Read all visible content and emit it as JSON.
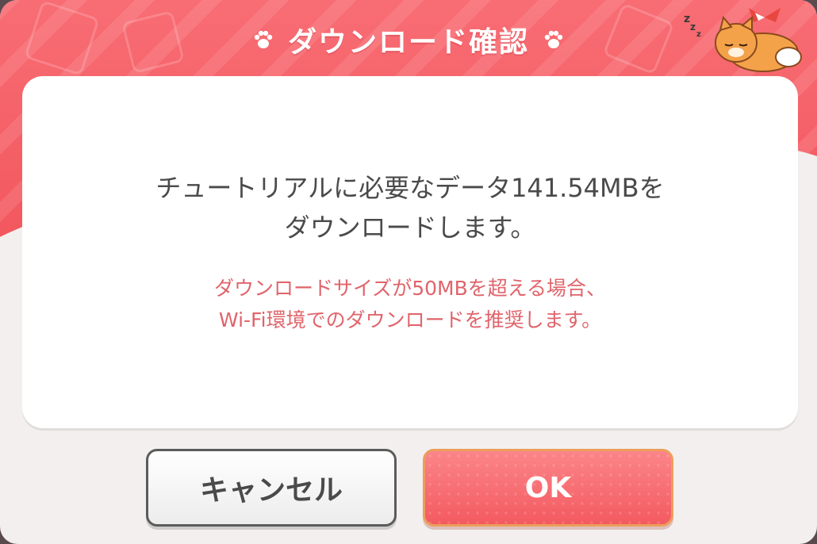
{
  "dialog": {
    "title": "ダウンロード確認",
    "message_line1": "チュートリアルに必要なデータ141.54MBを",
    "message_line2": "ダウンロードします。",
    "warning_line1": "ダウンロードサイズが50MBを超える場合、",
    "warning_line2": "Wi-Fi環境でのダウンロードを推奨します。"
  },
  "buttons": {
    "cancel_label": "キャンセル",
    "ok_label": "OK"
  },
  "icons": {
    "title_left": "paw-icon",
    "title_right": "paw-icon",
    "mascot": "sleeping-fox-mascot"
  },
  "colors": {
    "header": "#f2555c",
    "ok_button": "#f35a60",
    "warning_text": "#e0646b",
    "body_text": "#4a4a4a"
  }
}
